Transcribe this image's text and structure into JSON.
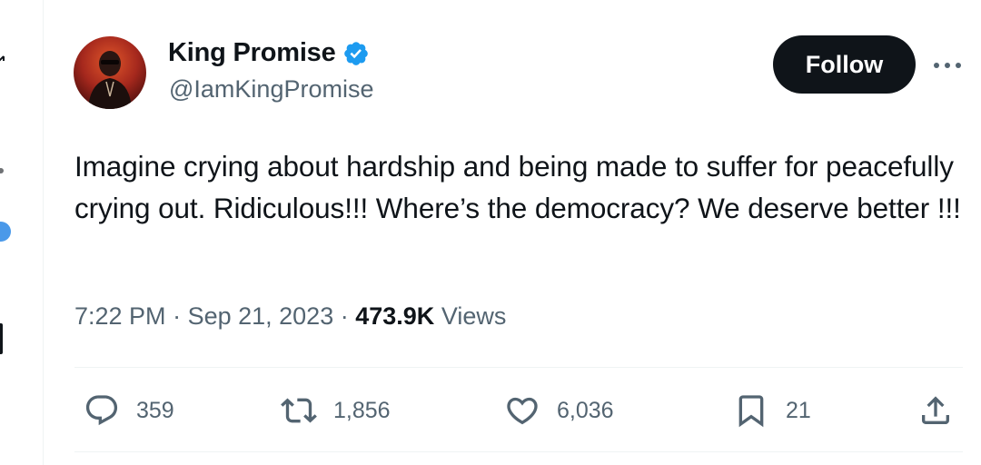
{
  "author": {
    "name": "King Promise",
    "handle": "@IamKingPromise",
    "verified": true
  },
  "follow_label": "Follow",
  "tweet": {
    "text": "Imagine crying about hardship and being made to suffer for peacefully crying out. Ridiculous!!! Where’s the democracy? We deserve better !!!",
    "time": "7:22 PM",
    "date": "Sep 21, 2023",
    "views_count": "473.9K",
    "views_label": "Views"
  },
  "actions": {
    "replies": "359",
    "reposts": "1,856",
    "likes": "6,036",
    "bookmarks": "21"
  },
  "colors": {
    "text": "#0f1419",
    "secondary": "#536471",
    "verified": "#1d9bf0",
    "divider": "#eff3f4"
  },
  "icons": [
    "reply-icon",
    "retweet-icon",
    "heart-icon",
    "bookmark-icon",
    "share-icon",
    "more-icon",
    "verified-icon"
  ]
}
